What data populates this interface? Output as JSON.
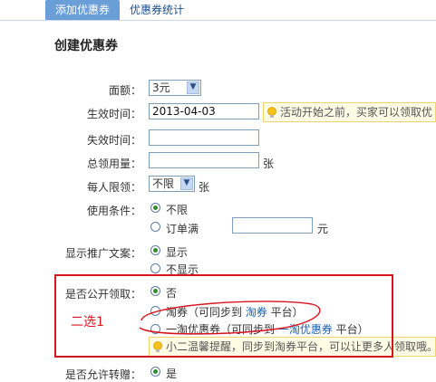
{
  "tabs": {
    "add": "添加优惠券",
    "stats": "优惠券统计"
  },
  "heading": "创建优惠券",
  "form": {
    "amount": {
      "label": "面额：",
      "value": "3元"
    },
    "start": {
      "label": "生效时间：",
      "value": "2013-04-03",
      "tip": "活动开始之前，买家可以领取优"
    },
    "expire": {
      "label": "失效时间：",
      "value": ""
    },
    "total": {
      "label": "总领用量：",
      "value": "",
      "unit": "张"
    },
    "per_user": {
      "label": "每人限领：",
      "value": "不限",
      "unit": "张"
    },
    "condition": {
      "label": "使用条件：",
      "opt_unlimited": "不限",
      "opt_min": "订单满",
      "min_value": "",
      "unit": "元"
    },
    "promo": {
      "label": "显示推广文案：",
      "opt_show": "显示",
      "opt_hide": "不显示"
    },
    "public": {
      "label": "是否公开领取：",
      "opt_no": "否",
      "opt_taoquan_pre": "淘券（可同步到 ",
      "opt_taoquan_link": "淘券",
      "opt_taoquan_post": " 平台）",
      "opt_yitao_pre": "一淘优惠券（可同步到 ",
      "opt_yitao_link": "一淘优惠券",
      "opt_yitao_post": " 平台）",
      "tip": "小二温馨提醒，同步到淘券平台，可以让更多人领取哦。"
    },
    "gift": {
      "label": "是否允许转赠：",
      "opt_yes": "是"
    }
  },
  "annotation": "二选1",
  "colors": {
    "annotation_red": "#d8141e",
    "tab_blue": "#6a9ed6",
    "radio_green": "#2f8e2b"
  }
}
